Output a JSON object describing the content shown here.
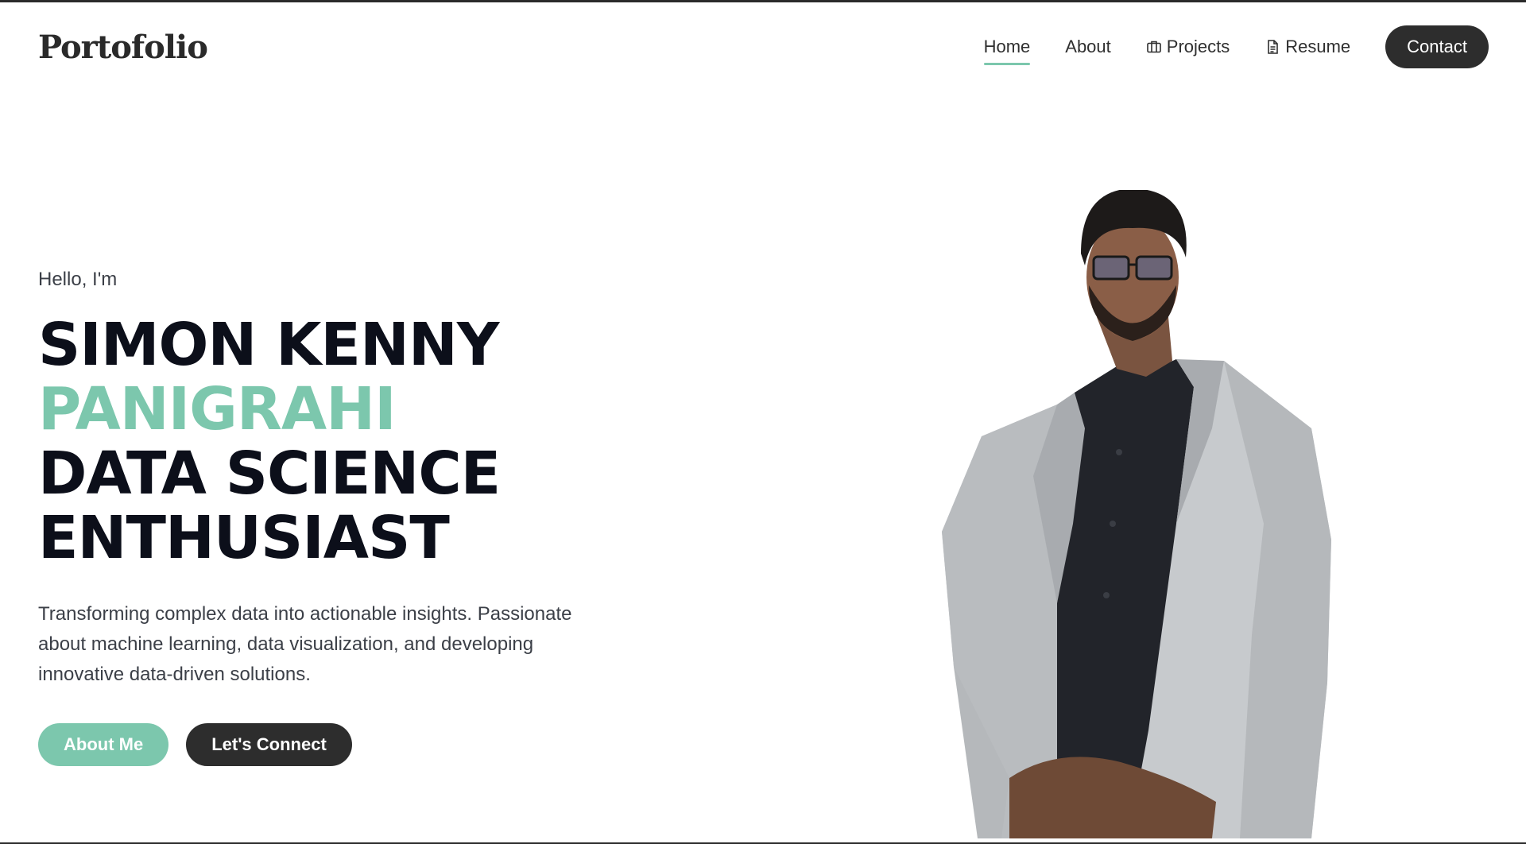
{
  "header": {
    "logo": "Portofolio",
    "nav": [
      {
        "label": "Home",
        "icon": null,
        "active": true
      },
      {
        "label": "About",
        "icon": null,
        "active": false
      },
      {
        "label": "Projects",
        "icon": "briefcase-icon",
        "active": false
      },
      {
        "label": "Resume",
        "icon": "document-icon",
        "active": false
      }
    ],
    "contact_label": "Contact"
  },
  "hero": {
    "greeting": "Hello, I'm",
    "name_line1": "SIMON KENNY",
    "name_line2": "PANIGRAHI",
    "title_line1": "DATA SCIENCE",
    "title_line2": "ENTHUSIAST",
    "description": "Transforming complex data into actionable insights. Passionate about machine learning, data visualization, and developing innovative data-driven solutions.",
    "primary_button": "About Me",
    "secondary_button": "Let's Connect"
  },
  "colors": {
    "accent": "#7cc7ad",
    "dark": "#2d2d2d",
    "headline": "#0c0f1a"
  }
}
